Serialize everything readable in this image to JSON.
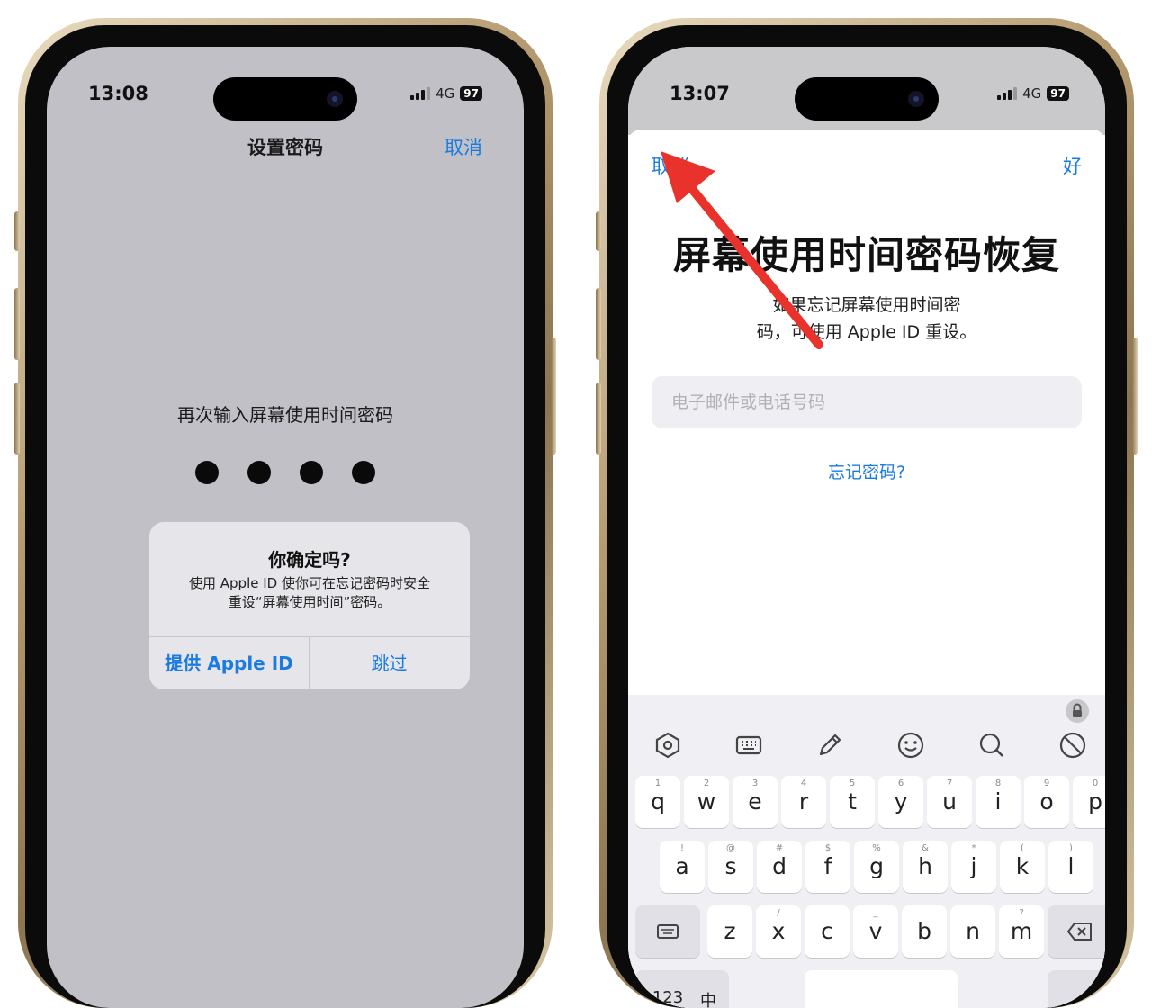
{
  "left_phone": {
    "time": "13:08",
    "network": "4G",
    "battery": "97",
    "title": "设置密码",
    "cancel_label": "取消",
    "prompt": "再次输入屏幕使用时间密码",
    "passcode_dots": 4,
    "alert": {
      "title": "你确定吗?",
      "message_line1": "使用 Apple ID 使你可在忘记密码时安全",
      "message_line2": "重设“屏幕使用时间”密码。",
      "primary_button": "提供 Apple ID",
      "secondary_button": "跳过"
    }
  },
  "right_phone": {
    "time": "13:07",
    "network": "4G",
    "battery": "97",
    "cancel_label": "取消",
    "ok_label": "好",
    "title": "屏幕使用时间密码恢复",
    "subtitle_line1": "如果忘记屏幕使用时间密",
    "subtitle_line2": "码，可使用 Apple ID 重设。",
    "input_placeholder": "电子邮件或电话号码",
    "forgot_link": "忘记密码?",
    "keyboard": {
      "row1": [
        {
          "main": "q",
          "sub": "1"
        },
        {
          "main": "w",
          "sub": "2"
        },
        {
          "main": "e",
          "sub": "3"
        },
        {
          "main": "r",
          "sub": "4"
        },
        {
          "main": "t",
          "sub": "5"
        },
        {
          "main": "y",
          "sub": "6"
        },
        {
          "main": "u",
          "sub": "7"
        },
        {
          "main": "i",
          "sub": "8"
        },
        {
          "main": "o",
          "sub": "9"
        },
        {
          "main": "p",
          "sub": "0"
        }
      ],
      "row2": [
        {
          "main": "a",
          "sub": "!"
        },
        {
          "main": "s",
          "sub": "@"
        },
        {
          "main": "d",
          "sub": "#"
        },
        {
          "main": "f",
          "sub": "$"
        },
        {
          "main": "g",
          "sub": "%"
        },
        {
          "main": "h",
          "sub": "&"
        },
        {
          "main": "j",
          "sub": "*"
        },
        {
          "main": "k",
          "sub": "("
        },
        {
          "main": "l",
          "sub": ")"
        }
      ],
      "row3": [
        {
          "main": "z",
          "sub": ""
        },
        {
          "main": "x",
          "sub": "/"
        },
        {
          "main": "c",
          "sub": ""
        },
        {
          "main": "v",
          "sub": "_"
        },
        {
          "main": "b",
          "sub": ""
        },
        {
          "main": "n",
          "sub": ""
        },
        {
          "main": "m",
          "sub": "?"
        }
      ],
      "row4": [
        "123",
        "中"
      ]
    }
  },
  "annotation": {
    "arrow_color": "#e8322b"
  }
}
